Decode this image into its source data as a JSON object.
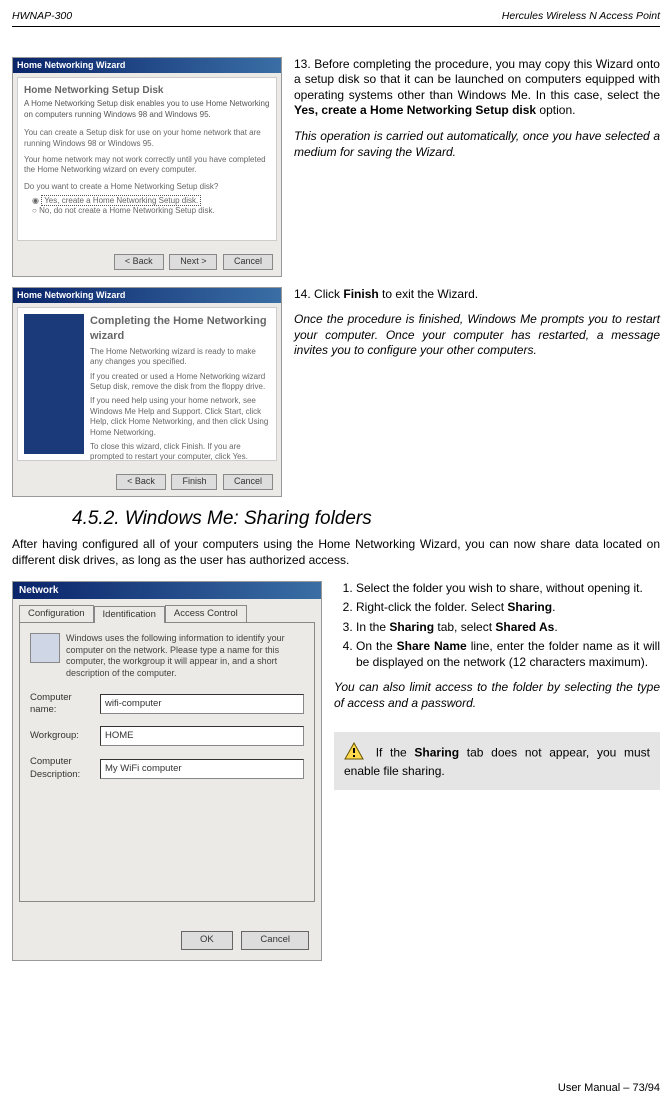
{
  "header": {
    "left": "HWNAP-300",
    "right": "Hercules Wireless N Access Point"
  },
  "block1": {
    "wizard_title": "Home Networking Wizard",
    "wizard_heading": "Home Networking Setup Disk",
    "wizard_sub": "A Home Networking Setup disk enables you to use Home Networking on computers running Windows 98 and Windows 95.",
    "wizard_body1": "You can create a Setup disk for use on your home network that are running Windows 98 or Windows 95.",
    "wizard_body2": "Your home network may not work correctly until you have completed the Home Networking wizard on every computer.",
    "wizard_q": "Do you want to create a Home Networking Setup disk?",
    "opt1": "Yes, create a Home Networking Setup disk.",
    "opt2": "No, do not create a Home Networking Setup disk.",
    "btn_back": "< Back",
    "btn_next": "Next >",
    "btn_cancel": "Cancel",
    "step": "13.",
    "step_text": "Before completing the procedure, you may copy this Wizard onto a setup disk so that it can be launched on computers equipped with operating systems other than Windows Me.  In this case, select the ",
    "step_bold": "Yes, create a Home Networking Setup disk",
    "step_end": " option.",
    "italic_text": "This operation is carried out automatically, once you have selected a medium for saving the Wizard."
  },
  "block2": {
    "wizard_title": "Home Networking Wizard",
    "wizard_heading": "Completing the Home Networking wizard",
    "wizard_body1": "The Home Networking wizard is ready to make any changes you specified.",
    "wizard_body2": "If you created or used a Home Networking wizard Setup disk, remove the disk from the floppy drive.",
    "wizard_body3": "If you need help using your home network, see Windows Me Help and Support. Click Start, click Help, click Home Networking, and then click Using Home Networking.",
    "wizard_body4": "To close this wizard, click Finish.  If you are prompted to restart your computer, click Yes.",
    "btn_back": "< Back",
    "btn_finish": "Finish",
    "btn_cancel": "Cancel",
    "step": "14.",
    "step_text1": "Click ",
    "step_bold": "Finish",
    "step_text2": " to exit the Wizard.",
    "italic_text": "Once the procedure is finished, Windows Me prompts you to restart your computer.  Once your computer has restarted, a message invites you to configure your other computers."
  },
  "heading": "4.5.2. Windows Me: Sharing folders",
  "intro": "After having configured all of your computers using the Home Networking Wizard, you can now share data located on different disk drives, as long as the user has authorized access.",
  "network": {
    "title": "Network",
    "tab1": "Configuration",
    "tab2": "Identification",
    "tab3": "Access Control",
    "desc": "Windows uses the following information to identify your computer on the network.  Please type a name for this computer, the workgroup it will appear in, and a short description of the computer.",
    "lbl_name": "Computer name:",
    "val_name": "wifi-computer",
    "lbl_wg": "Workgroup:",
    "val_wg": "HOME",
    "lbl_desc": "Computer Description:",
    "val_desc": "My WiFi computer",
    "btn_ok": "OK",
    "btn_cancel": "Cancel"
  },
  "steps": {
    "s1": "Select the folder you wish to share, without opening it.",
    "s2a": "Right-click the folder.  Select ",
    "s2b": "Sharing",
    "s2c": ".",
    "s3a": "In the ",
    "s3b": "Sharing",
    "s3c": " tab, select ",
    "s3d": "Shared As",
    "s3e": ".",
    "s4a": "On the ",
    "s4b": "Share Name",
    "s4c": " line, enter the folder name as it will be displayed on the network (12 characters maximum).",
    "italic": "You can also limit access to the folder by selecting the type of access and a password."
  },
  "warn": {
    "t1": " If the ",
    "t2": "Sharing",
    "t3": " tab does not appear, you must enable file sharing."
  },
  "footer": "User Manual – 73/94"
}
